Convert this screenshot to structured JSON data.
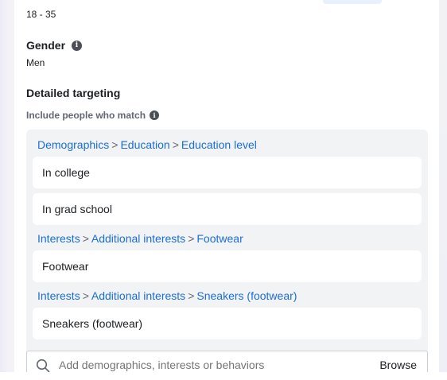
{
  "age": {
    "value": "18 - 35"
  },
  "gender": {
    "title": "Gender",
    "value": "Men"
  },
  "detailed_targeting": {
    "title": "Detailed targeting",
    "include_label": "Include people who match",
    "groups": [
      {
        "breadcrumb": [
          "Demographics",
          "Education",
          "Education level"
        ],
        "items": [
          "In college",
          "In grad school"
        ]
      },
      {
        "breadcrumb": [
          "Interests",
          "Additional interests",
          "Footwear"
        ],
        "items": [
          "Footwear"
        ]
      },
      {
        "breadcrumb": [
          "Interests",
          "Additional interests",
          "Sneakers (footwear)"
        ],
        "items": [
          "Sneakers (footwear)"
        ]
      }
    ],
    "breadcrumb_separator": ">"
  },
  "search": {
    "placeholder": "Add demographics, interests or behaviors",
    "browse_label": "Browse"
  },
  "icons": {
    "info": "info-icon",
    "search": "search-icon"
  },
  "colors": {
    "link": "#1a6ed8",
    "box_bg": "#f2f3f5"
  }
}
